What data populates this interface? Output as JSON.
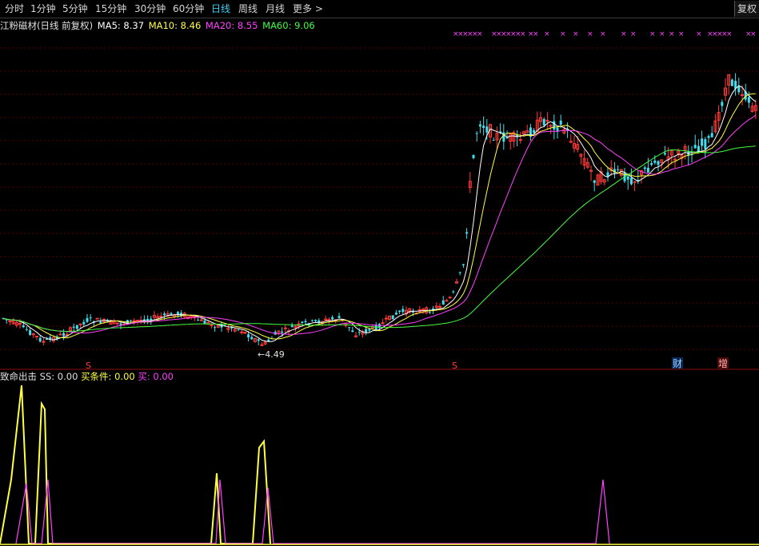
{
  "toolbar": {
    "tabs": [
      {
        "label": "分时",
        "active": false
      },
      {
        "label": "1分钟",
        "active": false
      },
      {
        "label": "5分钟",
        "active": false
      },
      {
        "label": "15分钟",
        "active": false
      },
      {
        "label": "30分钟",
        "active": false
      },
      {
        "label": "60分钟",
        "active": false
      },
      {
        "label": "日线",
        "active": true
      },
      {
        "label": "周线",
        "active": false
      },
      {
        "label": "月线",
        "active": false
      },
      {
        "label": "更多 >",
        "active": false
      }
    ],
    "adjust_button": "复权"
  },
  "main_legend": {
    "title": "江粉磁材(日线 前复权)",
    "ma5": "MA5: 8.37",
    "ma10": "MA10: 8.46",
    "ma20": "MA20: 8.55",
    "ma60": "MA60: 9.06"
  },
  "annotations": {
    "low_price": "←4.49",
    "marker_s": "S",
    "marker_cai": "财",
    "marker_zeng": "增",
    "x_mark": "×"
  },
  "indicator_legend": {
    "name": "致命出击",
    "ss": "SS: 0.00",
    "buy_cond": "买条件: 0.00",
    "buy": "买: 0.00"
  },
  "colors": {
    "up": "#ff3a3a",
    "down": "#3fe0f0",
    "ma5": "#ffffff",
    "ma10": "#ffff40",
    "ma20": "#ff40ff",
    "ma60": "#40ff40",
    "grid": "#5a0000",
    "active_tab": "#3fd0f0"
  }
}
